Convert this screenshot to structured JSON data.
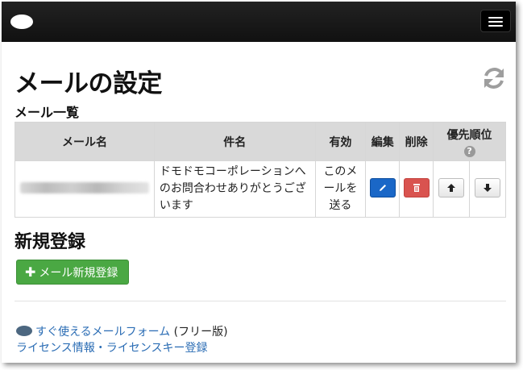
{
  "page": {
    "title": "メールの設定",
    "list_heading": "メール一覧",
    "new_heading": "新規登録"
  },
  "table": {
    "headers": {
      "name": "メール名",
      "subject": "件名",
      "enabled": "有効",
      "edit": "編集",
      "delete": "削除",
      "priority": "優先順位"
    },
    "rows": [
      {
        "name": "",
        "subject_line1": "ドモドモコーポレーションへ",
        "subject_line2": "のお問合わせありがとうござ",
        "subject_line3": "います",
        "enabled_line1": "このメ",
        "enabled_line2": "ールを",
        "enabled_line3": "送る"
      }
    ],
    "help_glyph": "?"
  },
  "buttons": {
    "add_label": "メール新規登録",
    "add_icon": "plus-icon"
  },
  "footer": {
    "product_link": "すぐ使えるメールフォーム",
    "product_suffix": "(フリー版)",
    "license_info": "ライセンス情報",
    "separator": "・",
    "license_register": "ライセンスキー登録"
  },
  "colors": {
    "navbar": "#111111",
    "edit_button": "#1a67c7",
    "delete_button": "#d9534f",
    "add_button": "#4aa843",
    "link": "#2a6cb4"
  }
}
